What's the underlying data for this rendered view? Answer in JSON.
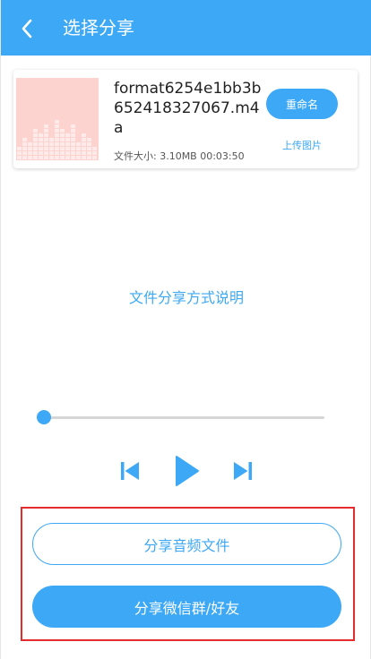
{
  "header": {
    "back_icon": "chevron-left-icon",
    "title": "选择分享"
  },
  "file_card": {
    "thumbnail_icon": "audio-waveform-icon",
    "file_name": "format6254e1bb3b652418327067.m4a",
    "meta": "文件大小:  3.10MB  00:03:50",
    "rename_label": "重命名",
    "upload_label": "上传图片"
  },
  "share_explain_label": "文件分享方式说明",
  "player": {
    "progress": 0,
    "prev_icon": "skip-previous-icon",
    "play_icon": "play-icon",
    "next_icon": "skip-next-icon"
  },
  "share_actions": {
    "share_audio_label": "分享音频文件",
    "share_wechat_label": "分享微信群/好友"
  },
  "colors": {
    "accent": "#3da8f5",
    "highlight_border": "#e52b2b",
    "thumbnail_bg": "#fdd3cf"
  }
}
